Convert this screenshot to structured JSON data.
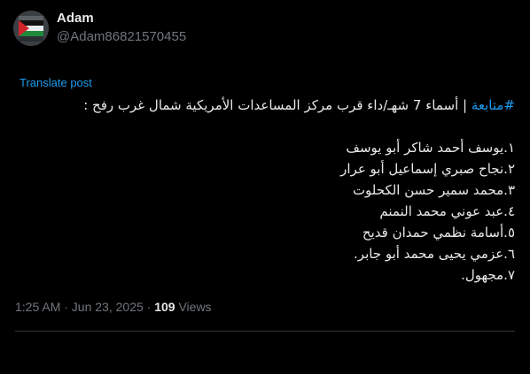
{
  "author": {
    "display_name": "Adam",
    "handle": "@Adam86821570455",
    "avatar_icon": "palestine-flag-avatar"
  },
  "translate_label": "Translate post",
  "post": {
    "hashtag": "#متابعة",
    "headline": " | أسماء 7 شهـ/داء قرب مركز المساعدات الأمريكية شمال غرب رفح :",
    "list": [
      "١.يوسف أحمد شاكر أبو يوسف",
      "٢.نجاح صبري إسماعيل أبو عرار",
      "٣.محمد سمير حسن الكحلوت",
      "٤.عبد عوني محمد النمنم",
      "٥.أسامة نظمي حمدان قديح",
      "٦.عزمي يحيى محمد أبو جابر.",
      "٧.مجهول."
    ]
  },
  "meta": {
    "timestamp": "1:25 AM · Jun 23, 2025",
    "separator": " · ",
    "views_count": "109",
    "views_label": " Views"
  },
  "colors": {
    "background": "#000000",
    "text": "#e7e9ea",
    "muted": "#71767b",
    "link": "#1d9bf0",
    "divider": "#2f3336"
  }
}
